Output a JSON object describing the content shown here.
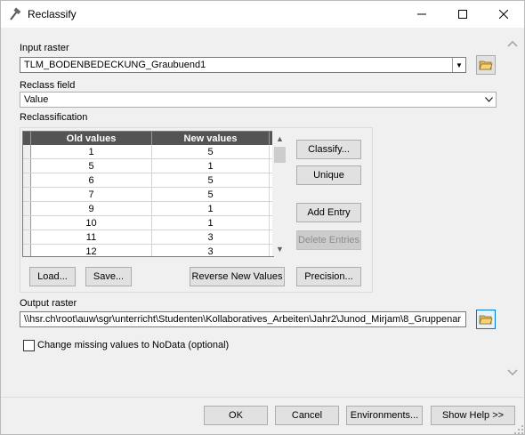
{
  "window": {
    "title": "Reclassify",
    "icon": "hammer-icon",
    "controls": {
      "minimize": "—",
      "maximize": "☐",
      "close": "✕"
    }
  },
  "input_raster": {
    "label": "Input raster",
    "value": "TLM_BODENBEDECKUNG_Graubuend1",
    "browse_icon": "folder-open-icon"
  },
  "reclass_field": {
    "label": "Reclass field",
    "value": "Value"
  },
  "reclassification": {
    "label": "Reclassification",
    "columns": {
      "old": "Old values",
      "new": "New values"
    },
    "rows": [
      {
        "old": "1",
        "new": "5"
      },
      {
        "old": "5",
        "new": "1"
      },
      {
        "old": "6",
        "new": "5"
      },
      {
        "old": "7",
        "new": "5"
      },
      {
        "old": "9",
        "new": "1"
      },
      {
        "old": "10",
        "new": "1"
      },
      {
        "old": "11",
        "new": "3"
      },
      {
        "old": "12",
        "new": "3"
      }
    ],
    "buttons": {
      "classify": "Classify...",
      "unique": "Unique",
      "add_entry": "Add Entry",
      "delete_entries": "Delete Entries",
      "load": "Load...",
      "save": "Save...",
      "reverse": "Reverse New Values",
      "precision": "Precision..."
    }
  },
  "output_raster": {
    "label": "Output raster",
    "value": "\\\\hsr.ch\\root\\auw\\sgr\\unterricht\\Studenten\\Kollaboratives_Arbeiten\\Jahr2\\Junod_Mirjam\\8_Gruppenar",
    "browse_icon": "folder-open-icon"
  },
  "options": {
    "missing_nodata_label": "Change missing values to NoData (optional)",
    "missing_nodata_checked": false
  },
  "footer": {
    "ok": "OK",
    "cancel": "Cancel",
    "environments": "Environments...",
    "show_help": "Show Help >>"
  }
}
